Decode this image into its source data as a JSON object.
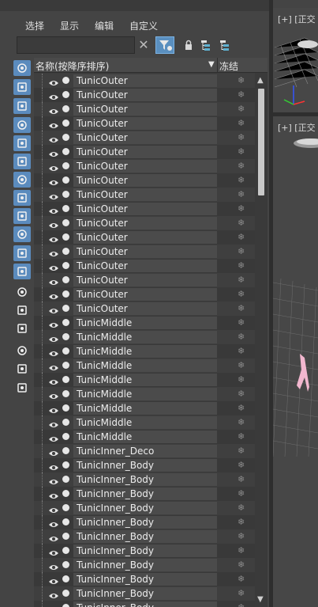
{
  "menu": {
    "items": [
      "选择",
      "显示",
      "编辑",
      "自定义"
    ]
  },
  "search": {
    "value": "",
    "placeholder": ""
  },
  "header": {
    "name_column": "名称(按降序排序)",
    "sort_arrow": "▼",
    "freeze_column": "冻结"
  },
  "icons": {
    "clear": "close-icon",
    "filter": "filter-icon",
    "lock": "lock-icon",
    "hierarchy": "hierarchy-icon"
  },
  "left_toolbar": [
    "display-geometry-icon",
    "display-shapes-icon",
    "display-lights-icon",
    "display-cameras-icon",
    "display-helpers-icon",
    "display-spacewarps-icon",
    "display-groups-icon",
    "display-xrefs-icon",
    "display-bones-icon",
    "display-containers-icon",
    "display-frozen-icon",
    "display-hidden-icon",
    "display-all-icon",
    "display-none-icon",
    "display-invert-icon",
    "filter-settings-icon",
    "filter-icon",
    "container-icon"
  ],
  "rows": [
    {
      "name": "TunicOuter"
    },
    {
      "name": "TunicOuter"
    },
    {
      "name": "TunicOuter"
    },
    {
      "name": "TunicOuter"
    },
    {
      "name": "TunicOuter"
    },
    {
      "name": "TunicOuter"
    },
    {
      "name": "TunicOuter"
    },
    {
      "name": "TunicOuter"
    },
    {
      "name": "TunicOuter"
    },
    {
      "name": "TunicOuter"
    },
    {
      "name": "TunicOuter"
    },
    {
      "name": "TunicOuter"
    },
    {
      "name": "TunicOuter"
    },
    {
      "name": "TunicOuter"
    },
    {
      "name": "TunicOuter"
    },
    {
      "name": "TunicOuter"
    },
    {
      "name": "TunicOuter"
    },
    {
      "name": "TunicMiddle"
    },
    {
      "name": "TunicMiddle"
    },
    {
      "name": "TunicMiddle"
    },
    {
      "name": "TunicMiddle"
    },
    {
      "name": "TunicMiddle"
    },
    {
      "name": "TunicMiddle"
    },
    {
      "name": "TunicMiddle"
    },
    {
      "name": "TunicMiddle"
    },
    {
      "name": "TunicMiddle"
    },
    {
      "name": "TunicInner_Deco"
    },
    {
      "name": "TunicInner_Body"
    },
    {
      "name": "TunicInner_Body"
    },
    {
      "name": "TunicInner_Body"
    },
    {
      "name": "TunicInner_Body"
    },
    {
      "name": "TunicInner_Body"
    },
    {
      "name": "TunicInner_Body"
    },
    {
      "name": "TunicInner_Body"
    },
    {
      "name": "TunicInner_Body"
    },
    {
      "name": "TunicInner_Body"
    },
    {
      "name": "TunicInner_Body"
    },
    {
      "name": "TunicInner_Body"
    }
  ],
  "freeze_glyph": "❄",
  "viewports": [
    {
      "label": "[+] [正交"
    },
    {
      "label": "[+] [正交"
    }
  ],
  "colors": {
    "accent": "#5b8bbd",
    "panel": "#444444",
    "list_bg": "#3d3d3d"
  }
}
